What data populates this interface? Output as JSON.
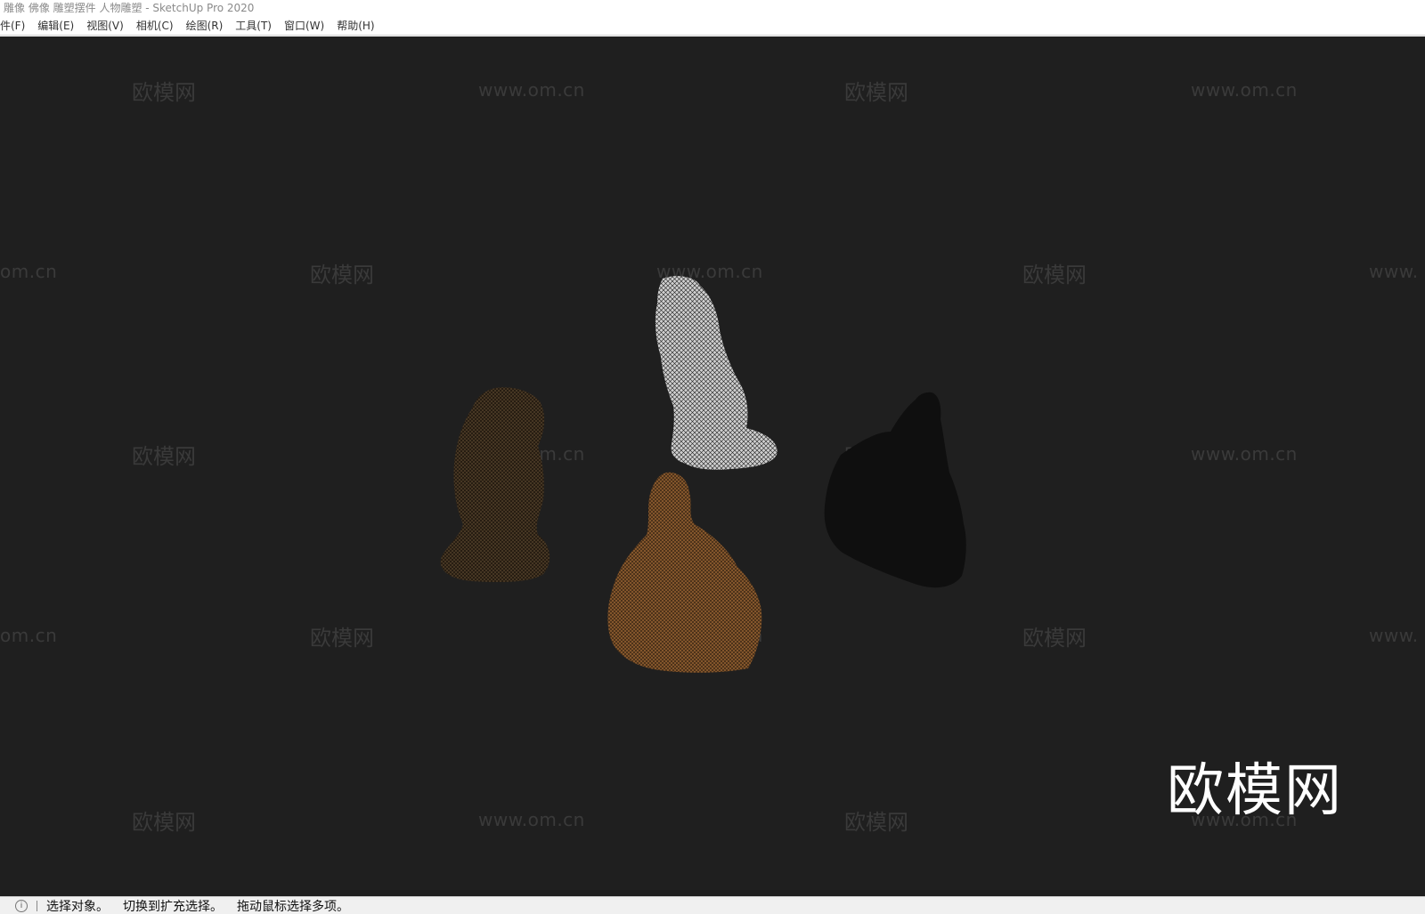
{
  "window": {
    "title": "雕像 佛像 雕塑摆件 人物雕塑 - SketchUp Pro 2020"
  },
  "menubar": {
    "items": [
      {
        "label": "件(F)"
      },
      {
        "label": "编辑(E)"
      },
      {
        "label": "视图(V)"
      },
      {
        "label": "相机(C)"
      },
      {
        "label": "绘图(R)"
      },
      {
        "label": "工具(T)"
      },
      {
        "label": "窗口(W)"
      },
      {
        "label": "帮助(H)"
      }
    ]
  },
  "viewport": {
    "background": "#1f1f1f",
    "models": [
      {
        "name": "sculpture-white-figure",
        "color": "#cfcfcf"
      },
      {
        "name": "sculpture-bronze-figure",
        "color": "#6b5032"
      },
      {
        "name": "sculpture-seated-buddha",
        "color": "#8a5a2e"
      },
      {
        "name": "sculpture-dark-silhouette",
        "color": "#0f0f0f"
      }
    ],
    "watermark_brand": "欧模网",
    "watermark_url": "www.om.cn",
    "watermark_url_partial_left": "om.cn",
    "watermark_url_partial_right": "www."
  },
  "status": {
    "icon": "info-icon",
    "hint1": "选择对象。",
    "hint2": "切换到扩充选择。",
    "hint3": "拖动鼠标选择多项。"
  }
}
